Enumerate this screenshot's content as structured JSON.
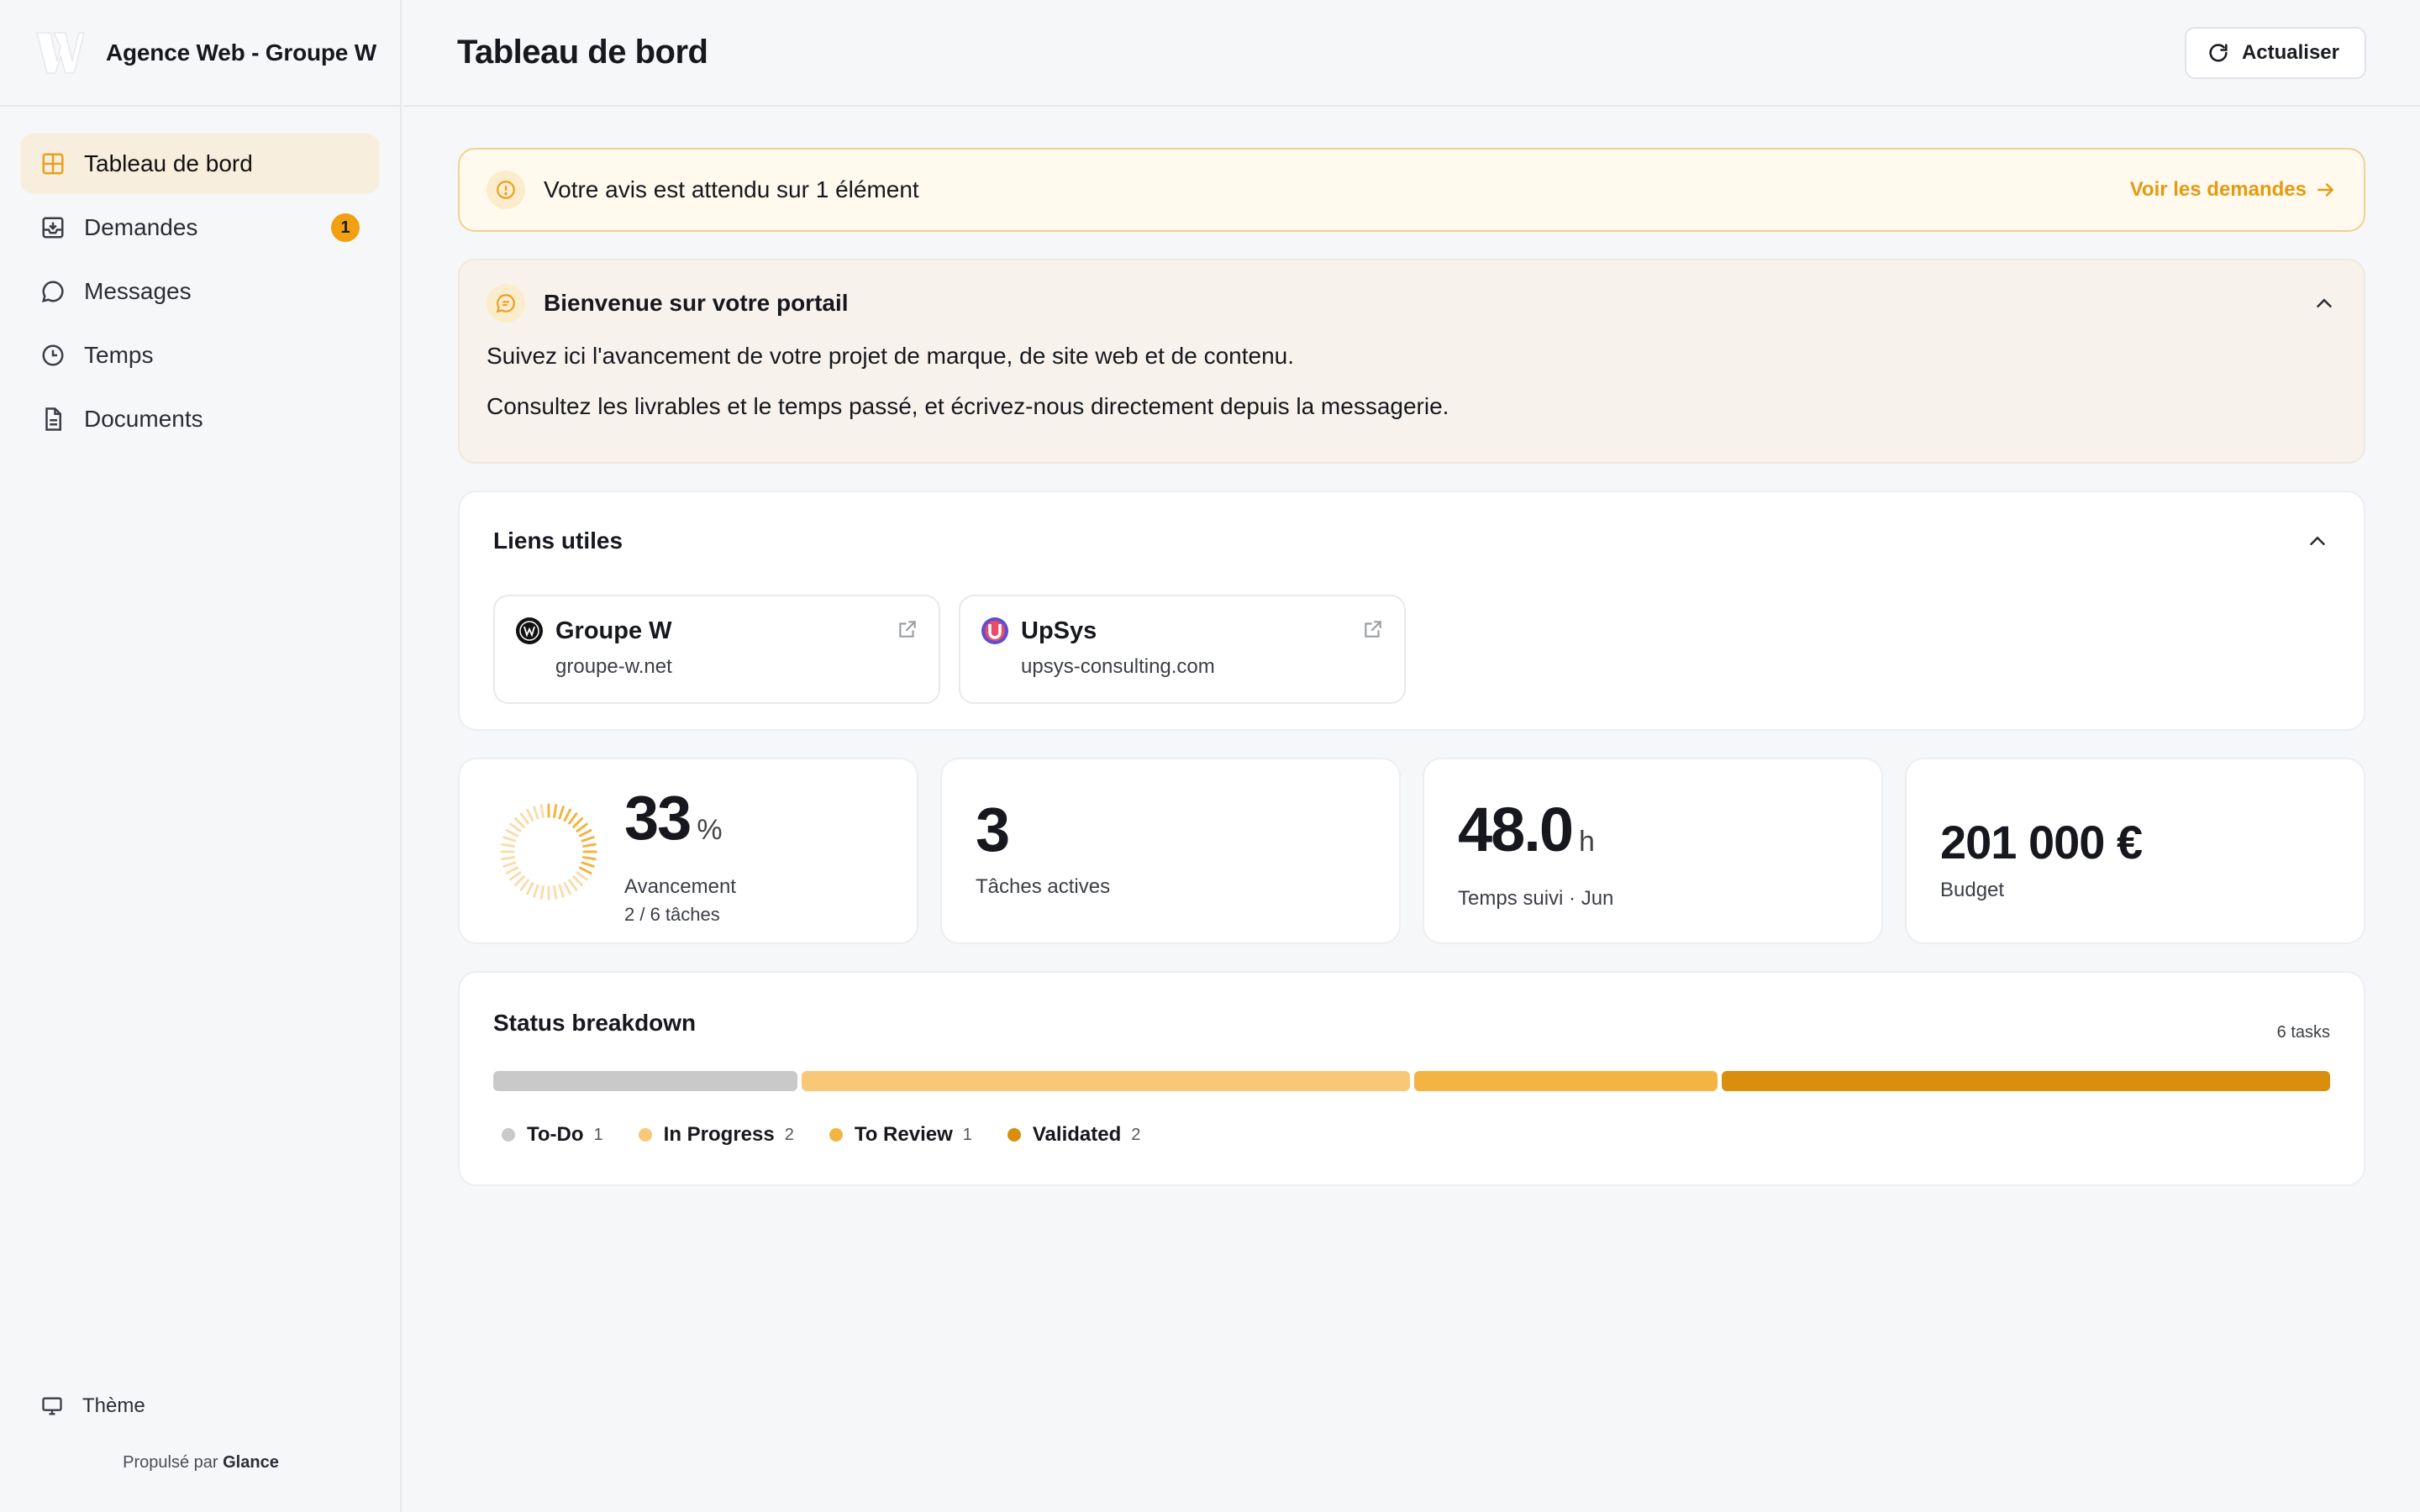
{
  "brand": {
    "name": "Agence Web - Groupe W",
    "logo_icon": "w-logo-icon"
  },
  "sidebar": {
    "items": [
      {
        "label": "Tableau de bord",
        "icon": "grid-icon",
        "active": true
      },
      {
        "label": "Demandes",
        "icon": "inbox-icon",
        "badge": "1"
      },
      {
        "label": "Messages",
        "icon": "chat-bubble-icon"
      },
      {
        "label": "Temps",
        "icon": "clock-icon"
      },
      {
        "label": "Documents",
        "icon": "document-icon"
      }
    ],
    "theme_label": "Thème",
    "powered_prefix": "Propulsé par",
    "powered_brand": "Glance"
  },
  "header": {
    "title": "Tableau de bord",
    "refresh_label": "Actualiser"
  },
  "alert": {
    "text": "Votre avis est attendu sur 1 élément",
    "link": "Voir les demandes"
  },
  "welcome": {
    "title": "Bienvenue sur votre portail",
    "line1": "Suivez ici l'avancement de votre projet de marque, de site web et de contenu.",
    "line2": "Consultez les livrables et le temps passé, et écrivez-nous directement depuis la messagerie."
  },
  "links": {
    "title": "Liens utiles",
    "items": [
      {
        "name": "Groupe W",
        "url": "groupe-w.net"
      },
      {
        "name": "UpSys",
        "url": "upsys-consulting.com"
      }
    ]
  },
  "stats": {
    "progress": {
      "value": "33",
      "unit": "%",
      "label": "Avancement",
      "sub": "2 / 6 tâches",
      "fraction": 0.33
    },
    "active_tasks": {
      "value": "3",
      "label": "Tâches actives"
    },
    "time": {
      "value": "48.0",
      "unit": "h",
      "label": "Temps suivi · Jun"
    },
    "budget": {
      "value": "201 000 €",
      "label": "Budget"
    }
  },
  "status": {
    "title": "Status breakdown",
    "count_label": "6 tasks",
    "segments": [
      {
        "name": "To-Do",
        "count": 1,
        "color": "#c9c9c9"
      },
      {
        "name": "In Progress",
        "count": 2,
        "color": "#f8c878"
      },
      {
        "name": "To Review",
        "count": 1,
        "color": "#f3b443"
      },
      {
        "name": "Validated",
        "count": 2,
        "color": "#d98e0e"
      }
    ]
  },
  "colors": {
    "accent": "#f0a010",
    "accent_text": "#e59a10"
  }
}
